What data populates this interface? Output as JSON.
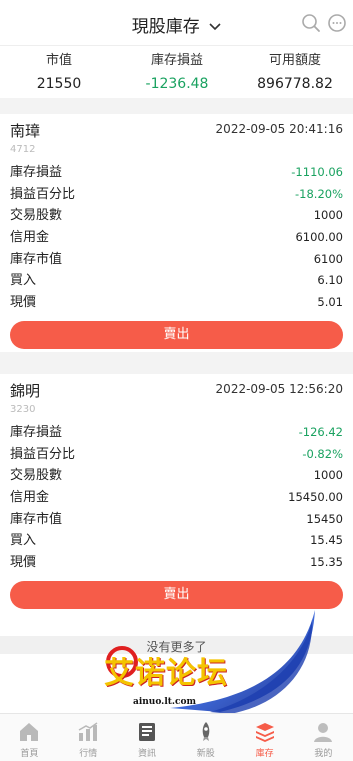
{
  "header": {
    "title": "現股庫存"
  },
  "summary": {
    "cols": [
      {
        "label": "市值",
        "value": "21550"
      },
      {
        "label": "庫存損益",
        "value": "-1236.48"
      },
      {
        "label": "可用額度",
        "value": "896778.82"
      }
    ]
  },
  "positions": [
    {
      "name": "南璋",
      "code": "4712",
      "time": "2022-09-05 20:41:16",
      "rows": [
        {
          "label": "庫存損益",
          "value": "-1110.06"
        },
        {
          "label": "損益百分比",
          "value": "-18.20%"
        },
        {
          "label": "交易股數",
          "value": "1000"
        },
        {
          "label": "信用金",
          "value": "6100.00"
        },
        {
          "label": "庫存市值",
          "value": "6100"
        },
        {
          "label": "買入",
          "value": "6.10"
        },
        {
          "label": "現價",
          "value": "5.01"
        }
      ],
      "sell_label": "賣出"
    },
    {
      "name": "錦明",
      "code": "3230",
      "time": "2022-09-05 12:56:20",
      "rows": [
        {
          "label": "庫存損益",
          "value": "-126.42"
        },
        {
          "label": "損益百分比",
          "value": "-0.82%"
        },
        {
          "label": "交易股數",
          "value": "1000"
        },
        {
          "label": "信用金",
          "value": "15450.00"
        },
        {
          "label": "庫存市值",
          "value": "15450"
        },
        {
          "label": "買入",
          "value": "15.45"
        },
        {
          "label": "現價",
          "value": "15.35"
        }
      ],
      "sell_label": "賣出"
    }
  ],
  "no_more": "没有更多了",
  "watermark": {
    "text": "艾诺论坛",
    "url": "ainuo.lt.com"
  },
  "tabs": [
    {
      "label": "首頁",
      "icon": "home-icon"
    },
    {
      "label": "行情",
      "icon": "market-chart-icon"
    },
    {
      "label": "資訊",
      "icon": "news-icon"
    },
    {
      "label": "新股",
      "icon": "rocket-icon"
    },
    {
      "label": "庫存",
      "icon": "stack-layers-icon",
      "active": true
    },
    {
      "label": "我的",
      "icon": "profile-icon"
    }
  ],
  "colors": {
    "accent": "#f65c49",
    "gain_loss_green": "#1aa260"
  }
}
